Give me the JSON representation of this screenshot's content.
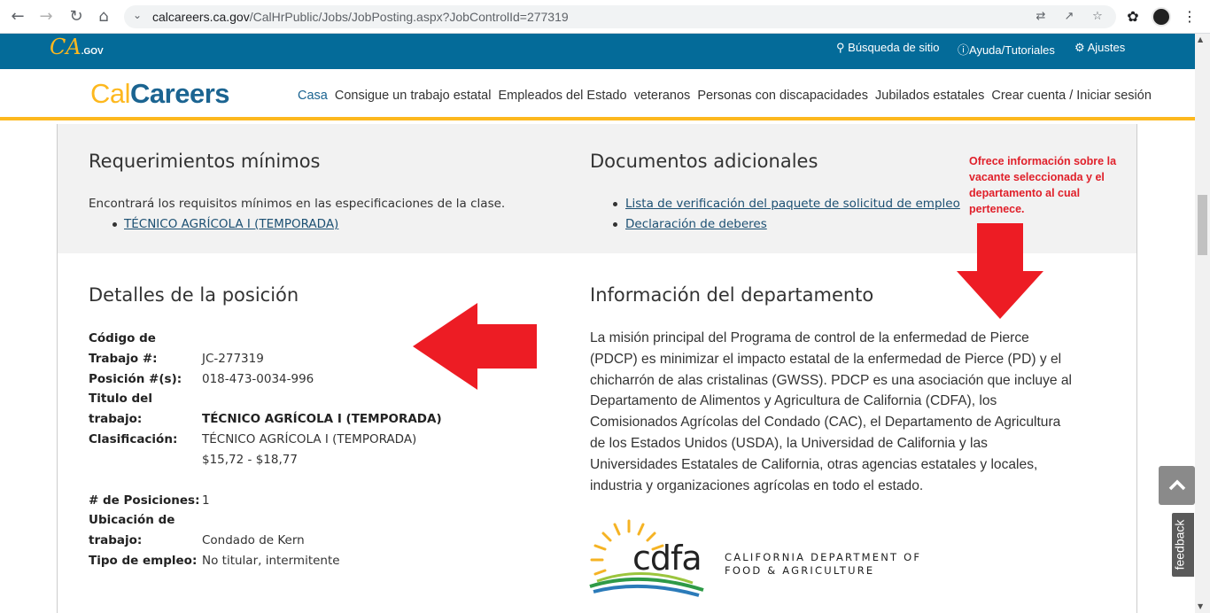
{
  "browser": {
    "url_host": "calcareers.ca.gov",
    "url_path": "/CalHrPublic/Jobs/JobPosting.aspx?JobControlId=277319"
  },
  "gov_bar": {
    "logo_text": "CA",
    "logo_suffix": ".GOV",
    "search_label": "Búsqueda de sitio",
    "help_label": "Ayuda/Tutoriales",
    "settings_label": "Ajustes"
  },
  "header": {
    "logo_cal": "Cal",
    "logo_careers": "Careers",
    "nav": {
      "home": "Casa",
      "state_job": "Consigue un trabajo estatal",
      "employees": "Empleados del Estado",
      "veterans": "veteranos",
      "disabilities": "Personas con discapacidades",
      "retirees": "Jubilados estatales",
      "account": "Crear cuenta / Iniciar sesión"
    }
  },
  "min_requirements": {
    "title": "Requerimientos mínimos",
    "text": "Encontrará los requisitos mínimos en las especificaciones de la clase.",
    "link": "TÉCNICO AGRÍCOLA I (TEMPORADA)"
  },
  "additional_docs": {
    "title": "Documentos adicionales",
    "links": [
      "Lista de verificación del paquete de solicitud de empleo",
      "Declaración de deberes"
    ]
  },
  "annotation": {
    "text": "Ofrece información sobre la vacante seleccionada y el departamento al cual pertenece."
  },
  "position_details": {
    "title": "Detalles de la posición",
    "job_code_label_1": "Código de",
    "job_code_label_2": "Trabajo #:",
    "job_code": "JC-277319",
    "position_label": "Posición #(s):",
    "position": "018-473-0034-996",
    "job_title_label_1": "Titulo del",
    "job_title_label_2": "trabajo:",
    "job_title": "TÉCNICO AGRÍCOLA I (TEMPORADA)",
    "classification_label": "Clasificación:",
    "classification": "TÉCNICO AGRÍCOLA I (TEMPORADA)",
    "salary": "$15,72 - $18,77",
    "num_positions_label": "# de Posiciones:",
    "num_positions": "1",
    "location_label_1": "Ubicación de",
    "location_label_2": "trabajo:",
    "location": "Condado de Kern",
    "employment_type_label": "Tipo de empleo:",
    "employment_type": "No titular, intermitente"
  },
  "department_info": {
    "title": "Información del departamento",
    "lines": [
      "La misión principal del Programa de control de la enfermedad de Pierce",
      "(PDCP) es minimizar el impacto estatal de la enfermedad de Pierce (PD) y el",
      "chicharrón de alas cristalinas (GWSS). PDCP es una asociación que incluye al",
      "Departamento de Alimentos y Agricultura de California (CDFA), los",
      "Comisionados Agrícolas del Condado (CAC), el Departamento de Agricultura",
      "de los Estados Unidos (USDA), la Universidad de California y las",
      "Universidades Estatales de California, otras agencias estatales y locales,",
      "industria y organizaciones agrícolas en todo el estado."
    ],
    "logo_wordmark": "cdfa",
    "logo_line1": "CALIFORNIA DEPARTMENT OF",
    "logo_line2": "FOOD & AGRICULTURE"
  },
  "widgets": {
    "feedback_label": "feedback"
  },
  "colors": {
    "gov_blue": "#046b99",
    "gold": "#fdb81e",
    "annotation_red": "#e0202a"
  }
}
